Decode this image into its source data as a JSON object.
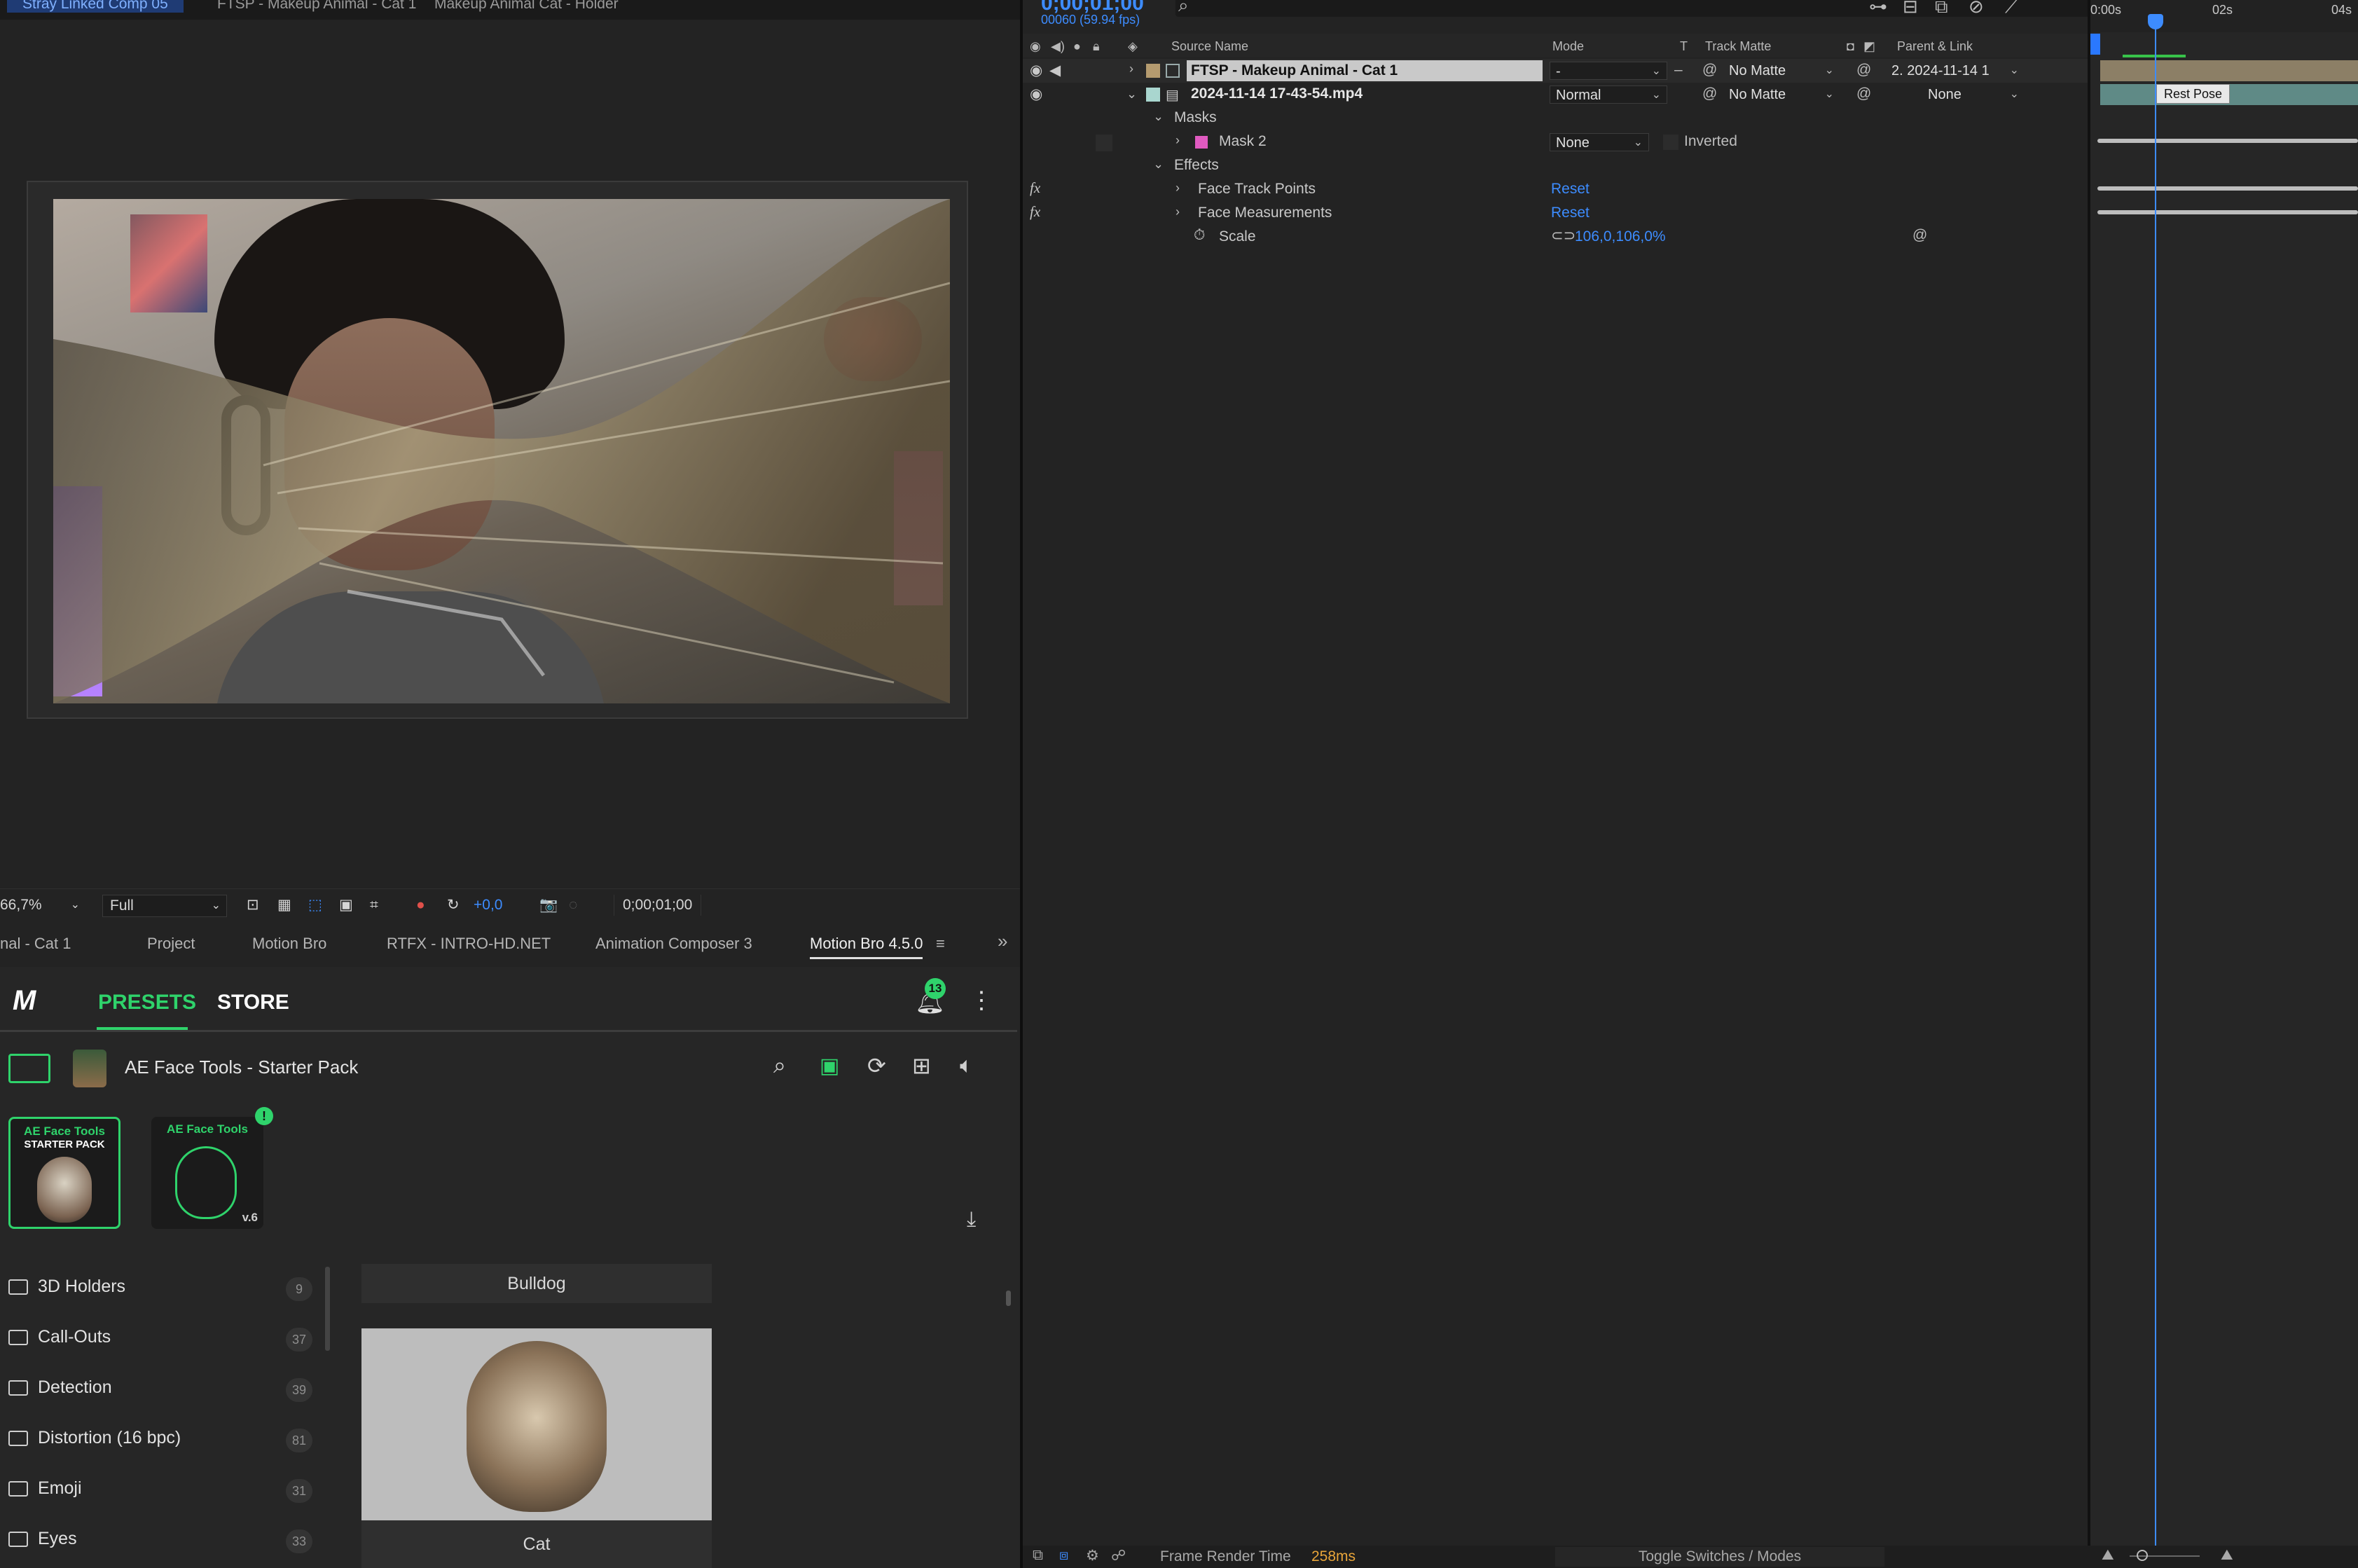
{
  "viewer": {
    "tabs": [
      "Stray Linked Comp 05",
      "FTSP - Makeup Animal - Cat 1",
      "Makeup Animal Cat - Holder"
    ],
    "zoom": "66,7%",
    "resolution": "Full",
    "exposure": "+0,0",
    "timecode": "0;00;01;00"
  },
  "panel": {
    "tabs": [
      "nal - Cat 1",
      "Project",
      "Motion Bro",
      "RTFX - INTRO-HD.NET",
      "Animation Composer 3",
      "Motion Bro 4.5.0"
    ],
    "active_tab": "Motion Bro 4.5.0",
    "nav": {
      "presets": "PRESETS",
      "store": "STORE"
    },
    "notification_count": "13",
    "pack_title": "AE Face Tools - Starter Pack",
    "thumbs": [
      {
        "line1": "AE Face Tools",
        "line2": "STARTER PACK",
        "selected": true
      },
      {
        "line1": "AE Face Tools",
        "badge": "v.6",
        "update_badge": "!"
      }
    ],
    "categories": [
      {
        "label": "3D Holders",
        "count": "9"
      },
      {
        "label": "Call-Outs",
        "count": "37"
      },
      {
        "label": "Detection",
        "count": "39"
      },
      {
        "label": "Distortion (16 bpc)",
        "count": "81"
      },
      {
        "label": "Emoji",
        "count": "31"
      },
      {
        "label": "Eyes",
        "count": "33"
      }
    ],
    "presets": [
      {
        "label": "Bulldog"
      },
      {
        "label": "Cat"
      }
    ]
  },
  "timeline": {
    "current_time": "0;00;01;00",
    "frame_info": "00060 (59.94 fps)",
    "ruler": [
      "0:00s",
      "02s",
      "04s"
    ],
    "columns": {
      "source_name": "Source Name",
      "mode": "Mode",
      "t": "T",
      "track_matte": "Track Matte",
      "parent": "Parent & Link"
    },
    "layers": [
      {
        "name": "FTSP - Makeup Animal - Cat 1",
        "mode": "-",
        "matte": "No Matte",
        "parent": "2. 2024-11-14 1",
        "label_color": "#b59b6f"
      },
      {
        "name": "2024-11-14 17-43-54.mp4",
        "mode": "Normal",
        "matte": "No Matte",
        "parent": "None",
        "label_color": "#a9d6cf"
      }
    ],
    "groups": {
      "masks": "Masks",
      "mask2": "Mask 2",
      "mask_mode": "None",
      "inverted": "Inverted",
      "effects": "Effects",
      "fx1": "Face Track Points",
      "fx2": "Face Measurements",
      "reset": "Reset",
      "scale": "Scale",
      "scale_value": "106,0,106,0%",
      "fx_symbol": "fx"
    },
    "marker": "Rest Pose",
    "footer": {
      "render_label": "Frame Render Time",
      "render_value": "258ms",
      "toggle": "Toggle Switches / Modes"
    }
  },
  "colors": {
    "accent_green": "#2fd36b",
    "ae_blue": "#3d8cff",
    "mask_pink": "#e05ac0",
    "render_orange": "#e8a53a"
  }
}
